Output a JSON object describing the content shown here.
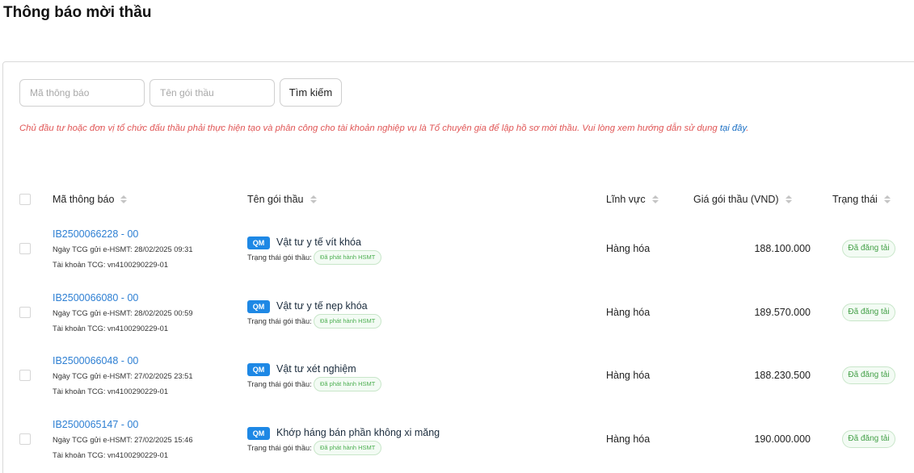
{
  "page": {
    "title": "Thông báo mời thầu"
  },
  "filters": {
    "code_placeholder": "Mã thông báo",
    "name_placeholder": "Tên gói thầu",
    "search_label": "Tìm kiếm"
  },
  "notice": {
    "text": "Chủ đầu tư hoặc đơn vị tổ chức đấu thầu phải thực hiện tạo và phân công cho tài khoản nghiệp vụ là Tổ chuyên gia để lập hồ sơ mời thầu. Vui lòng xem hướng dẫn sử dụng ",
    "link": "tại đây",
    "end": "."
  },
  "table": {
    "columns": {
      "code": "Mã thông báo",
      "name": "Tên gói thầu",
      "field": "Lĩnh vực",
      "price": "Giá gói thầu (VND)",
      "status": "Trạng thái"
    },
    "rows": [
      {
        "code": "IB2500066228 - 00",
        "sent": "Ngày TCG gửi e-HSMT: 28/02/2025 09:31",
        "account": "Tài khoản TCG: vn4100290229-01",
        "tag": "QM",
        "name": "Vật tư y tế vít khóa",
        "pkg_status_label": "Trạng thái gói thầu:",
        "pkg_status": "Đã phát hành HSMT",
        "field": "Hàng hóa",
        "price": "188.100.000",
        "status": "Đã đăng tải"
      },
      {
        "code": "IB2500066080 - 00",
        "sent": "Ngày TCG gửi e-HSMT: 28/02/2025 00:59",
        "account": "Tài khoản TCG: vn4100290229-01",
        "tag": "QM",
        "name": "Vật tư y tế nẹp khóa",
        "pkg_status_label": "Trạng thái gói thầu:",
        "pkg_status": "Đã phát hành HSMT",
        "field": "Hàng hóa",
        "price": "189.570.000",
        "status": "Đã đăng tải"
      },
      {
        "code": "IB2500066048 - 00",
        "sent": "Ngày TCG gửi e-HSMT: 27/02/2025 23:51",
        "account": "Tài khoản TCG: vn4100290229-01",
        "tag": "QM",
        "name": "Vật tư xét nghiệm",
        "pkg_status_label": "Trạng thái gói thầu:",
        "pkg_status": "Đã phát hành HSMT",
        "field": "Hàng hóa",
        "price": "188.230.500",
        "status": "Đã đăng tải"
      },
      {
        "code": "IB2500065147 - 00",
        "sent": "Ngày TCG gửi e-HSMT: 27/02/2025 15:46",
        "account": "Tài khoản TCG: vn4100290229-01",
        "tag": "QM",
        "name": "Khớp háng bán phần không xi măng",
        "pkg_status_label": "Trạng thái gói thầu:",
        "pkg_status": "Đã phát hành HSMT",
        "field": "Hàng hóa",
        "price": "190.000.000",
        "status": "Đã đăng tải"
      }
    ]
  },
  "colors": {
    "link": "#2d7fd3",
    "notice": "#e05555",
    "tag": "#1e88e5",
    "status_green": "#43a047"
  }
}
